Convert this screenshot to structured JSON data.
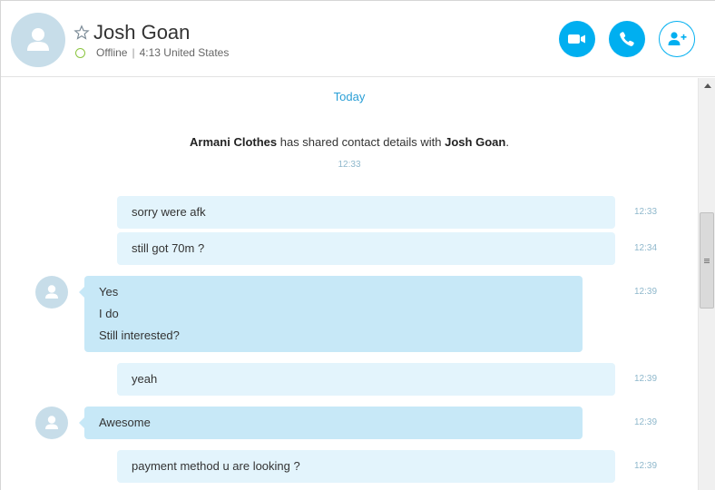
{
  "header": {
    "contact_name": "Josh Goan",
    "status": "Offline",
    "separator": "|",
    "local_time": "4:13 United States",
    "icons": {
      "favorite": "star-outline-icon",
      "video": "video-camera-icon",
      "call": "phone-icon",
      "add": "add-contact-icon",
      "status": "offline-status-icon"
    },
    "colors": {
      "accent": "#00aff0",
      "offline": "#8bc53f"
    }
  },
  "chat": {
    "day_divider": "Today",
    "system_message": {
      "sender": "Armani Clothes",
      "text": " has shared contact details with ",
      "target": "Josh Goan",
      "suffix": ".",
      "time": "12:33"
    },
    "messages": [
      {
        "direction": "out",
        "lines": [
          "sorry were afk"
        ],
        "time": "12:33"
      },
      {
        "direction": "out",
        "lines": [
          "still got 70m ?"
        ],
        "time": "12:34"
      },
      {
        "direction": "in",
        "lines": [
          "Yes",
          "I do",
          "Still interested?"
        ],
        "time": "12:39"
      },
      {
        "direction": "out",
        "lines": [
          "yeah"
        ],
        "time": "12:39"
      },
      {
        "direction": "in",
        "lines": [
          "Awesome"
        ],
        "time": "12:39"
      },
      {
        "direction": "out",
        "lines": [
          "payment method u are looking ?"
        ],
        "time": "12:39"
      }
    ],
    "colors": {
      "outgoing_bubble": "#e3f4fc",
      "incoming_bubble": "#c7e8f7",
      "timestamp": "#8fb8cc",
      "divider": "#2a9fd6"
    }
  }
}
